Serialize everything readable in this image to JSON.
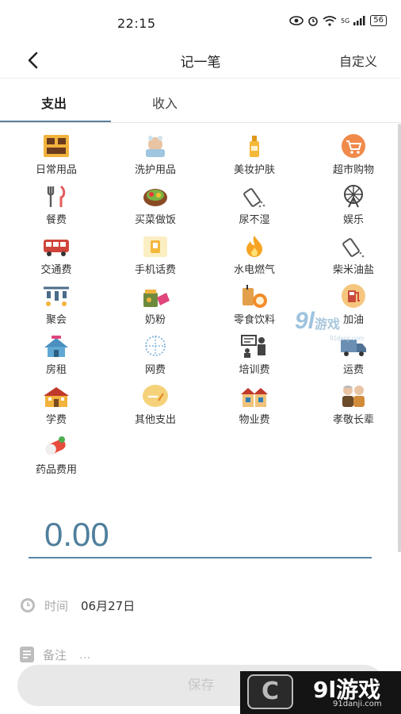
{
  "status": {
    "time": "22:15",
    "network": "5G",
    "battery": "56"
  },
  "header": {
    "title": "记一笔",
    "custom_label": "自定义"
  },
  "tabs": [
    {
      "label": "支出",
      "active": true
    },
    {
      "label": "收入",
      "active": false
    }
  ],
  "categories": [
    {
      "label": "日常用品",
      "icon": "daily-goods-icon"
    },
    {
      "label": "洗护用品",
      "icon": "toiletries-icon"
    },
    {
      "label": "美妆护肤",
      "icon": "cosmetics-icon"
    },
    {
      "label": "超市购物",
      "icon": "supermarket-cart-icon"
    },
    {
      "label": "餐费",
      "icon": "fork-knife-icon"
    },
    {
      "label": "买菜做饭",
      "icon": "cooking-pot-icon"
    },
    {
      "label": "尿不湿",
      "icon": "powder-bottle-icon"
    },
    {
      "label": "娱乐",
      "icon": "ferris-wheel-icon"
    },
    {
      "label": "交通费",
      "icon": "bus-icon"
    },
    {
      "label": "手机话费",
      "icon": "phone-bill-icon"
    },
    {
      "label": "水电燃气",
      "icon": "flame-icon"
    },
    {
      "label": "柴米油盐",
      "icon": "salt-shaker-icon"
    },
    {
      "label": "聚会",
      "icon": "party-lanterns-icon"
    },
    {
      "label": "奶粉",
      "icon": "milk-powder-icon"
    },
    {
      "label": "零食饮料",
      "icon": "snack-drink-icon"
    },
    {
      "label": "加油",
      "icon": "fuel-pump-icon"
    },
    {
      "label": "房租",
      "icon": "house-icon"
    },
    {
      "label": "网费",
      "icon": "network-globe-icon"
    },
    {
      "label": "培训费",
      "icon": "training-icon"
    },
    {
      "label": "运费",
      "icon": "truck-icon"
    },
    {
      "label": "学费",
      "icon": "school-icon"
    },
    {
      "label": "其他支出",
      "icon": "other-expense-icon"
    },
    {
      "label": "物业费",
      "icon": "property-building-icon"
    },
    {
      "label": "孝敬长辈",
      "icon": "elders-icon"
    },
    {
      "label": "药品费用",
      "icon": "medicine-pill-icon"
    }
  ],
  "amount": "0.00",
  "time_row": {
    "label": "时间",
    "value": "06月27日"
  },
  "note_row": {
    "label": "备注",
    "placeholder": "..."
  },
  "save_label": "保存",
  "watermark": {
    "brand": "游戏",
    "number": "9l",
    "url": "91danji.com"
  },
  "colors": {
    "accent": "#5a87a5",
    "amount": "#4f7f9c",
    "save_bg": "#e8e8e8"
  }
}
